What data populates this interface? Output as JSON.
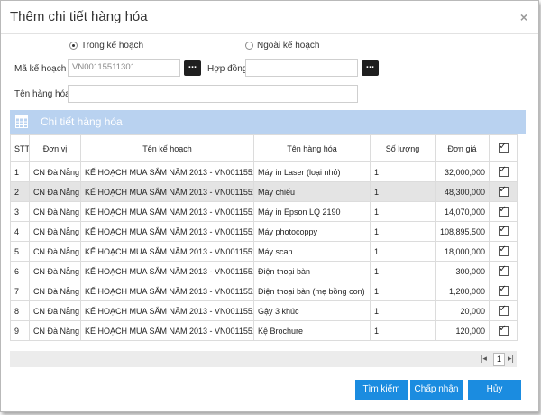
{
  "dialog": {
    "title": "Thêm chi tiết hàng hóa",
    "close": "×"
  },
  "form": {
    "radio_plan": "Trong kế hoạch",
    "radio_other": "Ngoài kế hoạch",
    "plan_code_label": "Mã kế hoạch",
    "plan_code_value": "VN00115511301",
    "contract_label": "Hợp đồng",
    "contract_value": "",
    "browse": "...",
    "goods_label": "Tên hàng hóa",
    "goods_value": ""
  },
  "section": {
    "title": "Chi tiết hàng hóa"
  },
  "table": {
    "headers": [
      "STT",
      "Đơn vị",
      "Tên kế hoạch",
      "Tên hàng hóa",
      "Số lượng",
      "Đơn giá"
    ],
    "rows": [
      [
        "1",
        "CN Đà Nẵng",
        "KẾ HOẠCH MUA SẮM NĂM 2013 - VN0011551",
        "Máy in Laser (loại nhỏ)",
        "1",
        "32,000,000"
      ],
      [
        "2",
        "CN Đà Nẵng",
        "KẾ HOẠCH MUA SẮM NĂM 2013 - VN0011551",
        "Máy chiếu",
        "1",
        "48,300,000"
      ],
      [
        "3",
        "CN Đà Nẵng",
        "KẾ HOẠCH MUA SẮM NĂM 2013 - VN0011551",
        "Máy in Epson LQ 2190",
        "1",
        "14,070,000"
      ],
      [
        "4",
        "CN Đà Nẵng",
        "KẾ HOẠCH MUA SẮM NĂM 2013 - VN0011551",
        "Máy photocoppy",
        "1",
        "108,895,500"
      ],
      [
        "5",
        "CN Đà Nẵng",
        "KẾ HOẠCH MUA SẮM NĂM 2013 - VN0011551",
        "Máy scan",
        "1",
        "18,000,000"
      ],
      [
        "6",
        "CN Đà Nẵng",
        "KẾ HOẠCH MUA SẮM NĂM 2013 - VN0011551",
        "Điện thoại bàn",
        "1",
        "300,000"
      ],
      [
        "7",
        "CN Đà Nẵng",
        "KẾ HOẠCH MUA SẮM NĂM 2013 - VN0011551",
        "Điện thoại bàn (mẹ bồng con)",
        "1",
        "1,200,000"
      ],
      [
        "8",
        "CN Đà Nẵng",
        "KẾ HOẠCH MUA SẮM NĂM 2013 - VN0011551",
        "Gậy 3  khúc",
        "1",
        "20,000"
      ],
      [
        "9",
        "CN Đà Nẵng",
        "KẾ HOẠCH MUA SẮM NĂM 2013 - VN0011551",
        "Kệ Brochure",
        "1",
        "120,000"
      ]
    ],
    "selected_row": 2
  },
  "pager": {
    "first": "|◂",
    "page": "1",
    "last": "▸|"
  },
  "buttons": {
    "search": "Tìm kiếm",
    "accept": "Chấp nhận",
    "cancel": "Hủy"
  }
}
